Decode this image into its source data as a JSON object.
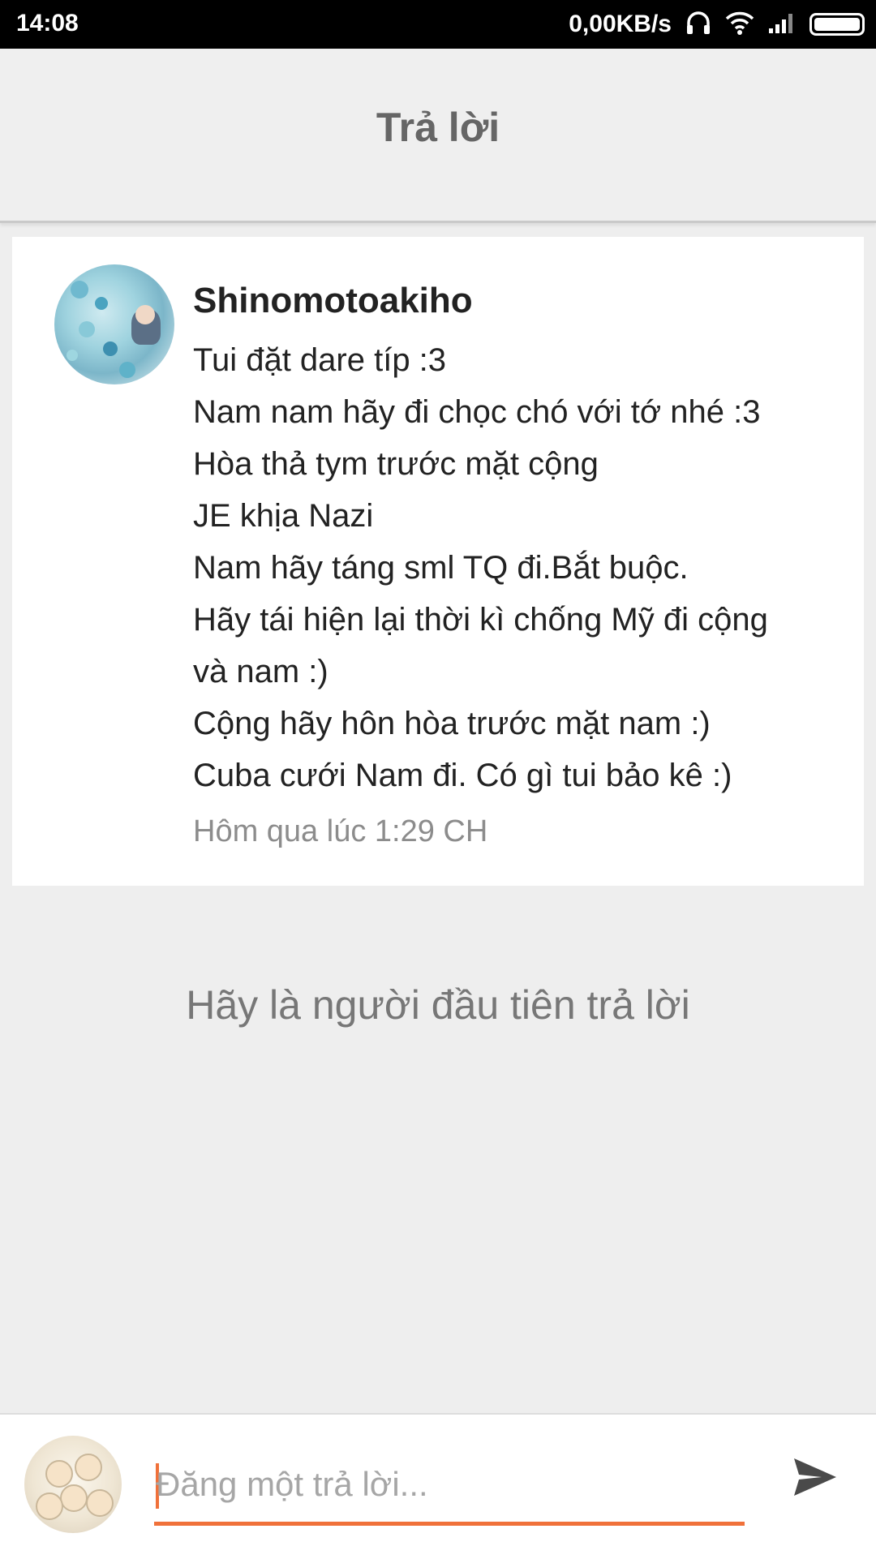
{
  "status_bar": {
    "time": "14:08",
    "network_speed": "0,00KB/s"
  },
  "header": {
    "title": "Trả lời"
  },
  "comment": {
    "username": "Shinomotoakiho",
    "lines": [
      "Tui đặt dare típ :3",
      "Nam nam hãy đi chọc chó với tớ nhé :3",
      "Hòa thả tym trước mặt cộng",
      "JE khịa Nazi",
      "Nam hãy táng sml TQ đi.Bắt buộc.",
      "Hãy tái hiện lại thời kì chống Mỹ đi cộng",
      "và nam :)",
      "Cộng hãy hôn hòa trước mặt nam :)",
      "Cuba cưới Nam đi. Có gì tui bảo kê :)"
    ],
    "timestamp": "Hôm qua lúc 1:29 CH"
  },
  "empty_state": {
    "text": "Hãy là người đầu tiên trả lời"
  },
  "reply": {
    "placeholder": "Đăng một trả lời...",
    "value": ""
  },
  "icons": {
    "send": "send-icon",
    "wifi": "wifi-icon",
    "signal": "signal-icon",
    "headphones": "headphones-icon",
    "battery": "battery-icon"
  },
  "colors": {
    "accent": "#f0713a",
    "status_bar_bg": "#000000",
    "app_bar_bg": "#efefef",
    "page_bg": "#eeeeee"
  }
}
